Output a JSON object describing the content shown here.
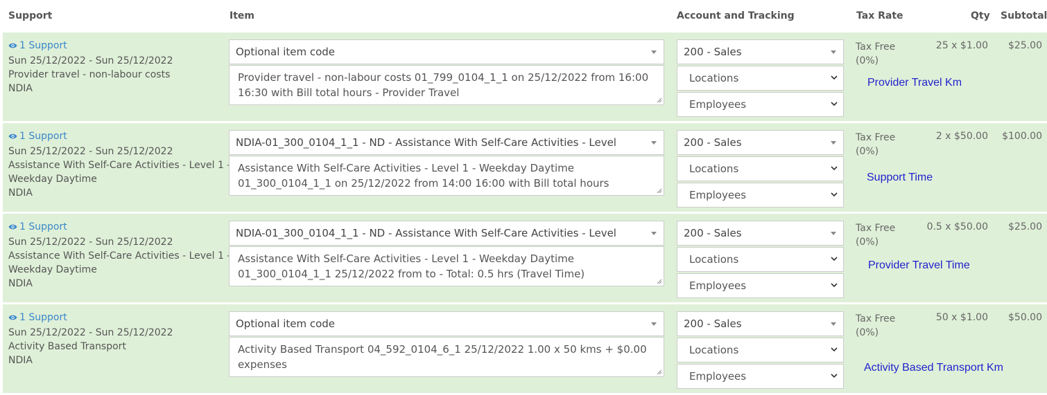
{
  "header": {
    "support": "Support",
    "item": "Item",
    "account": "Account and Tracking",
    "tax_rate": "Tax Rate",
    "qty": "Qty",
    "subtotal": "Subtotal"
  },
  "rows": [
    {
      "support_link": "1 Support",
      "support_lines": [
        "Sun 25/12/2022 - Sun 25/12/2022",
        "Provider travel - non-labour costs",
        "NDIA"
      ],
      "item_code": "Optional item code",
      "description": "Provider travel - non-labour costs 01_799_0104_1_1 on 25/12/2022 from 16:00 16:30 with Bill total hours - Provider Travel",
      "account": "200 - Sales",
      "locations": "Locations",
      "employees": "Employees",
      "tax_name": "Tax Free",
      "tax_pct": "(0%)",
      "qty": "25 x $1.00",
      "subtotal": "$25.00",
      "note": "Provider Travel Km"
    },
    {
      "support_link": "1 Support",
      "support_lines": [
        "Sun 25/12/2022 - Sun 25/12/2022",
        "Assistance With Self-Care Activities - Level 1 -",
        "Weekday Daytime",
        "NDIA"
      ],
      "item_code": "NDIA-01_300_0104_1_1 - ND - Assistance With Self-Care Activities - Level",
      "description": "Assistance With Self-Care Activities - Level 1 - Weekday Daytime 01_300_0104_1_1 on 25/12/2022 from 14:00 16:00 with Bill total hours",
      "account": "200 - Sales",
      "locations": "Locations",
      "employees": "Employees",
      "tax_name": "Tax Free",
      "tax_pct": "(0%)",
      "qty": "2 x $50.00",
      "subtotal": "$100.00",
      "note": "Support Time"
    },
    {
      "support_link": "1 Support",
      "support_lines": [
        "Sun 25/12/2022 - Sun 25/12/2022",
        "Assistance With Self-Care Activities - Level 1 -",
        "Weekday Daytime",
        "NDIA"
      ],
      "item_code": "NDIA-01_300_0104_1_1 - ND - Assistance With Self-Care Activities - Level",
      "description": "Assistance With Self-Care Activities - Level 1 - Weekday Daytime 01_300_0104_1_1 25/12/2022 from  to  - Total: 0.5 hrs (Travel Time)",
      "account": "200 - Sales",
      "locations": "Locations",
      "employees": "Employees",
      "tax_name": "Tax Free",
      "tax_pct": "(0%)",
      "qty": "0.5 x $50.00",
      "subtotal": "$25.00",
      "note": "Provider Travel Time"
    },
    {
      "support_link": "1 Support",
      "support_lines": [
        "Sun 25/12/2022 - Sun 25/12/2022",
        "Activity Based Transport",
        "NDIA"
      ],
      "item_code": "Optional item code",
      "description": "Activity Based Transport 04_592_0104_6_1 25/12/2022 1.00 x 50 kms + $0.00 expenses",
      "account": "200 - Sales",
      "locations": "Locations",
      "employees": "Employees",
      "tax_name": "Tax Free",
      "tax_pct": "(0%)",
      "qty": "50 x $1.00",
      "subtotal": "$50.00",
      "note": "Activity Based Transport Km"
    }
  ],
  "icons": {
    "view": "eye-icon",
    "select": "caret-down-icon",
    "dropdown": "chevron-down-icon",
    "resize": "resize-grip-icon"
  },
  "colors": {
    "row_bg": "#dff0d8",
    "link": "#3a87c8",
    "note": "#2222cc"
  }
}
